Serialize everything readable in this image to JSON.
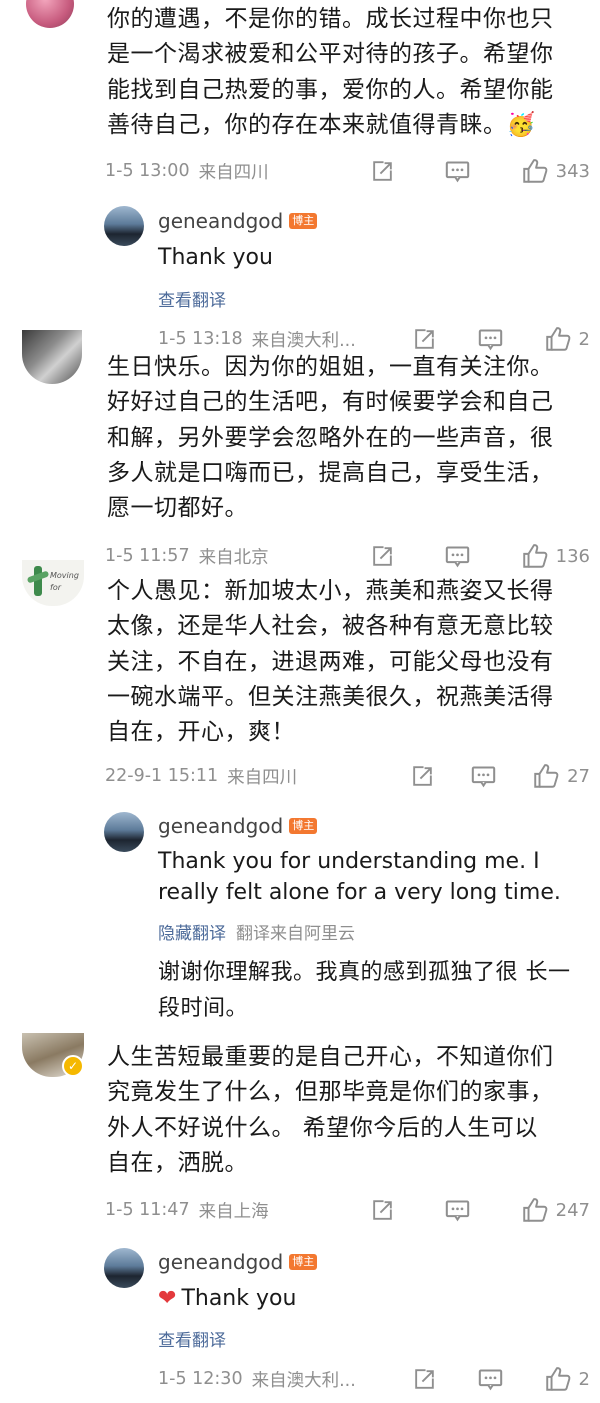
{
  "comments": [
    {
      "text": "你的遭遇，不是你的错。成长过程中你也只\n是一个渴求被爱和公平对待的孩子。希望你\n能找到自己热爱的事，爱你的人。希望你能\n善待自己，你的存在本来就值得青睐。🥳",
      "time": "1-5 13:00",
      "location": "来自四川",
      "likes": "343",
      "avatar_color": "#d96b8e"
    },
    {
      "text": "生日快乐。因为你的姐姐，一直有关注你。\n好好过自己的生活吧，有时候要学会和自己\n和解，另外要学会忽略外在的一些声音，很\n多人就是口嗨而已，提高自己，享受生活，\n愿一切都好。",
      "time": "1-5 11:57",
      "location": "来自北京",
      "likes": "136",
      "avatar_color": "#5b5b5b"
    },
    {
      "text": "个人愚见：新加坡太小，燕美和燕姿又长得\n太像，还是华人社会，被各种有意无意比较\n关注，不自在，进退两难，可能父母也没有\n一碗水端平。但关注燕美很久，祝燕美活得\n自在，开心，爽！",
      "time": "22-9-1 15:11",
      "location": "来自四川",
      "likes": "27",
      "avatar_text": "Moving for"
    },
    {
      "text": "人生苦短最重要的是自己开心，不知道你们\n究竟发生了什么，但那毕竟是你们的家事，\n外人不好说什么。 希望你今后的人生可以\n自在，洒脱。",
      "time": "1-5 11:47",
      "location": "来自上海",
      "likes": "247",
      "avatar_color": "#8a7a62"
    }
  ],
  "replies": [
    {
      "username": "geneandgod",
      "badge": "博主",
      "text": "Thank you",
      "link": "查看翻译",
      "time": "1-5 13:18",
      "location": "来自澳大利...",
      "likes": "2"
    },
    {
      "username": "geneandgod",
      "badge": "博主",
      "text": "Thank you for understanding me. I\nreally felt alone for a very long time.",
      "link": "隐藏翻译",
      "translation_source": "翻译来自阿里云",
      "translation": "谢谢你理解我。我真的感到孤独了很\n长一段时间。"
    },
    {
      "username": "geneandgod",
      "badge": "博主",
      "heart": "❤",
      "text": "Thank you",
      "link": "查看翻译",
      "time": "1-5 12:30",
      "location": "来自澳大利...",
      "likes": "2"
    }
  ],
  "icons": {
    "share": "share-icon",
    "comment": "comment-icon",
    "like": "thumbs-up-icon"
  },
  "colors": {
    "meta_gray": "#8f8f8f",
    "link_blue": "#4d6b9a",
    "badge_orange": "#f37830",
    "heart_red": "#e3393c"
  }
}
